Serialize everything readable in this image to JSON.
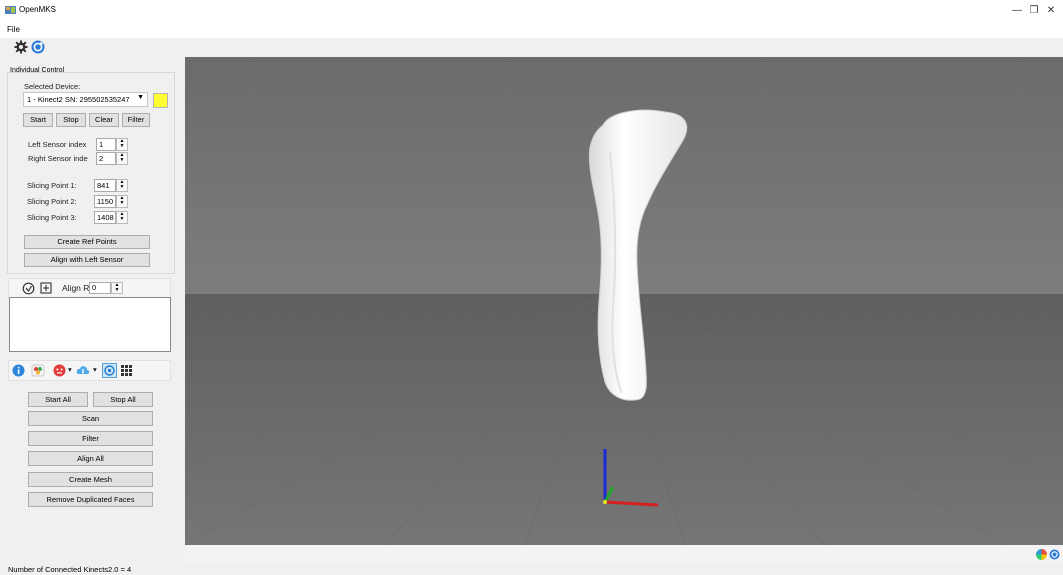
{
  "window": {
    "title": "OpenMKS",
    "minimize": "—",
    "maximize": "❐",
    "close": "✕"
  },
  "menu": {
    "file": "File"
  },
  "toolbar": {
    "icons": [
      "settings-icon",
      "refresh-icon"
    ]
  },
  "individual_control": {
    "group_title": "Individual Control",
    "selected_device_label": "Selected Device:",
    "selected_device_value": "1 - Kinect2 SN: 295502535247",
    "device_color": "#ffff33",
    "buttons": {
      "start": "Start",
      "stop": "Stop",
      "clear": "Clear",
      "filter": "Filter"
    },
    "left_sensor_label": "Left Sensor index",
    "left_sensor_value": "1",
    "right_sensor_label": "Right Sensor inde",
    "right_sensor_value": "2",
    "slicing": [
      {
        "label": "Slicing Point 1:",
        "value": "841"
      },
      {
        "label": "Slicing Point 2:",
        "value": "1150"
      },
      {
        "label": "Slicing Point 3:",
        "value": "1408"
      }
    ],
    "create_ref_points": "Create Ref Points",
    "align_left_sensor": "Align with Left Sensor"
  },
  "align_ref": {
    "label": "Align Ref.",
    "value": "0"
  },
  "global": {
    "start_all": "Start All",
    "stop_all": "Stop All",
    "scan": "Scan",
    "filter": "Filter",
    "align_all": "Align All",
    "create_mesh": "Create Mesh",
    "remove_duplicated_faces": "Remove Duplicated Faces"
  },
  "status_bar": {
    "text": "Number of Connected Kinects2.0 = 4"
  }
}
